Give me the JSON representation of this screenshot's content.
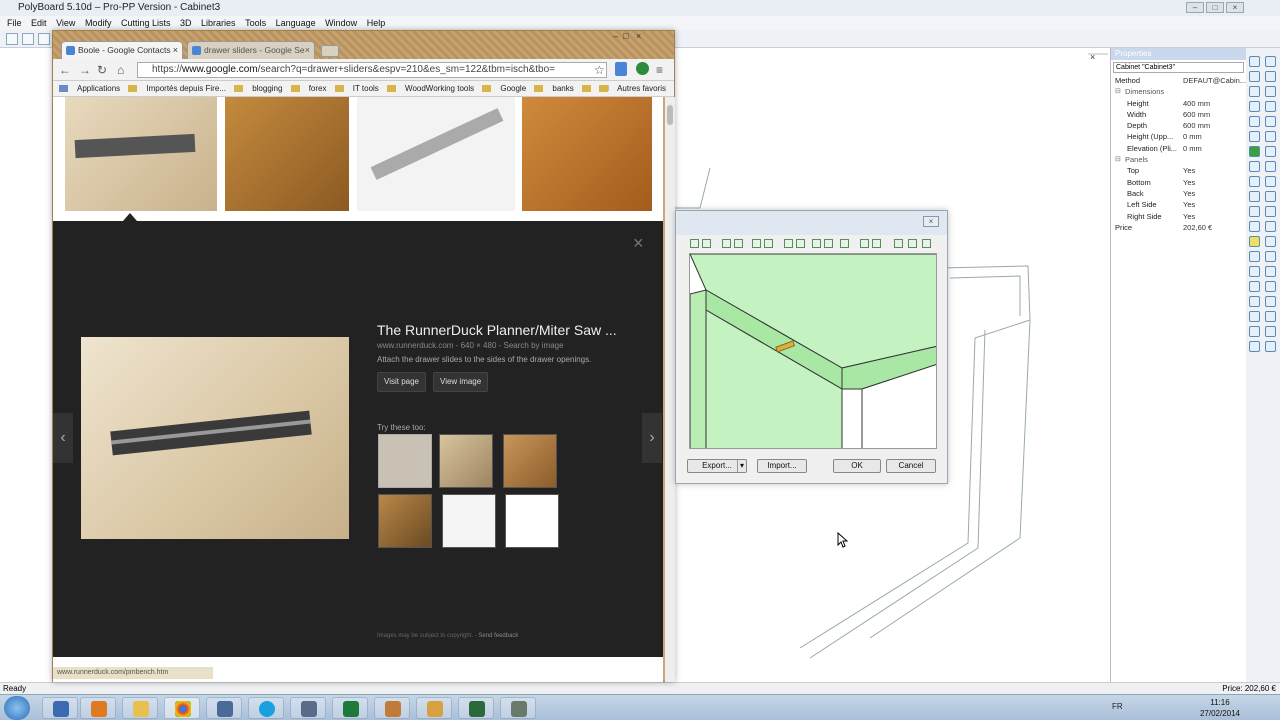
{
  "polyboard": {
    "title": "PolyBoard 5.10d – Pro-PP Version - Cabinet3",
    "menu": [
      "File",
      "Edit",
      "View",
      "Modify",
      "Cutting Lists",
      "3D",
      "Libraries",
      "Tools",
      "Language",
      "Window",
      "Help"
    ],
    "properties": {
      "header": "Properties",
      "selector": "Cabinet \"Cabinet3\"",
      "rows": [
        {
          "k": "Method",
          "v": "DEFAUT@Cabin...",
          "kind": "top"
        },
        {
          "k": "Dimensions",
          "v": "",
          "kind": "grp"
        },
        {
          "k": "Height",
          "v": "400 mm",
          "kind": ""
        },
        {
          "k": "Width",
          "v": "600 mm",
          "kind": ""
        },
        {
          "k": "Depth",
          "v": "600 mm",
          "kind": ""
        },
        {
          "k": "Height (Upp...",
          "v": "0 mm",
          "kind": ""
        },
        {
          "k": "Elevation (Pli...",
          "v": "0 mm",
          "kind": ""
        },
        {
          "k": "Panels",
          "v": "",
          "kind": "grp"
        },
        {
          "k": "Top",
          "v": "Yes",
          "kind": ""
        },
        {
          "k": "Bottom",
          "v": "Yes",
          "kind": ""
        },
        {
          "k": "Back",
          "v": "Yes",
          "kind": ""
        },
        {
          "k": "Left Side",
          "v": "Yes",
          "kind": ""
        },
        {
          "k": "Right Side",
          "v": "Yes",
          "kind": ""
        },
        {
          "k": "Price",
          "v": "202,60 €",
          "kind": "top"
        }
      ]
    },
    "status_left": "Ready",
    "status_right": "Price: 202,60 €"
  },
  "chrome": {
    "tabs": [
      "Boole - Google Contacts",
      "drawer sliders - Google Se"
    ],
    "url_prefix": "https://",
    "url_host": "www.google.com",
    "url_rest": "/search?q=drawer+sliders&espv=210&es_sm=122&tbm=isch&tbo=",
    "bookmarks": [
      "Applications",
      "Importés depuis Fire...",
      "blogging",
      "forex",
      "IT tools",
      "WoodWorking tools",
      "Google",
      "banks",
      "IM"
    ],
    "bookmarks_right": "Autres favoris",
    "result": {
      "title": "The RunnerDuck Planner/Miter Saw ...",
      "meta": "www.runnerduck.com - 640 × 480 - Search by image",
      "desc": "Attach the drawer slides to the sides of the drawer openings.",
      "visit": "Visit page",
      "view": "View image",
      "try": "Try these too:",
      "legal": "Images may be subject to copyright.",
      "feedback": "Send feedback"
    },
    "status_url": "www.runnerduck.com/pmbench.htm"
  },
  "dialog": {
    "export": "Export...",
    "import": "Import...",
    "ok": "OK",
    "cancel": "Cancel"
  },
  "taskbar": {
    "lang": "FR",
    "time": "11:16",
    "date": "27/02/2014"
  }
}
